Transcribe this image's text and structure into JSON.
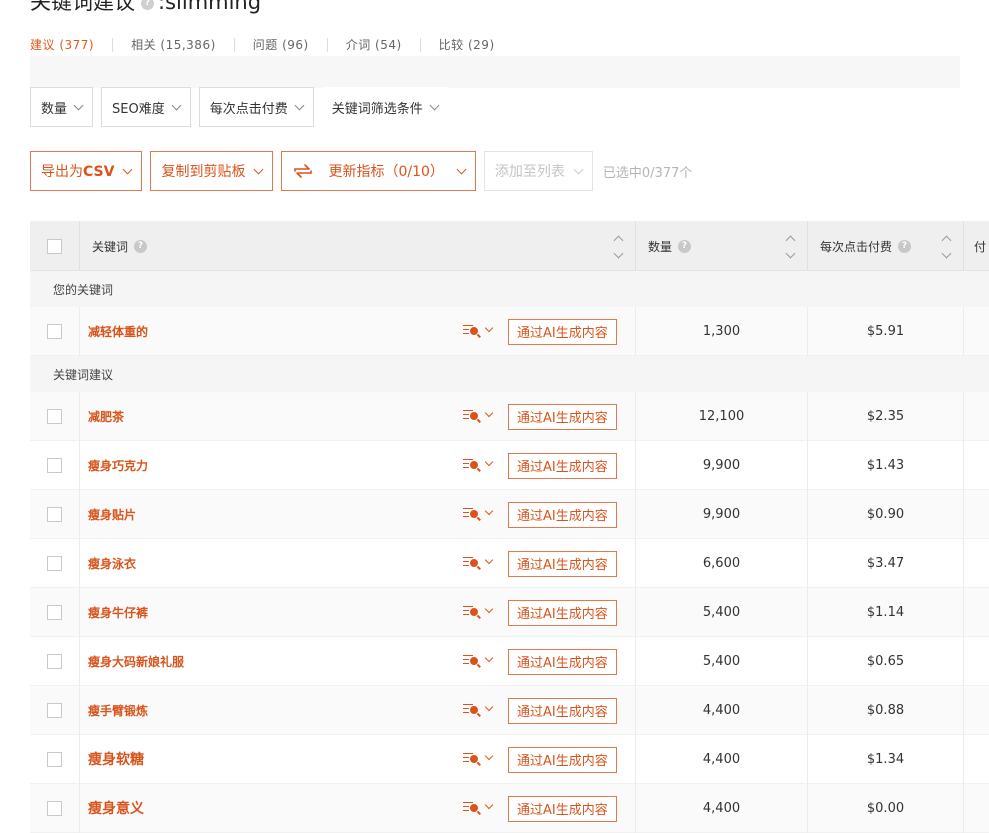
{
  "header": {
    "title": "关键词建议",
    "title_sep": ":",
    "query": "slimming",
    "help_glyph": "?"
  },
  "tabs": [
    {
      "label": "建议 (377)",
      "active": true
    },
    {
      "label": "相关 (15,386)",
      "active": false
    },
    {
      "label": "问题 (96)",
      "active": false
    },
    {
      "label": "介词 (54)",
      "active": false
    },
    {
      "label": "比较 (29)",
      "active": false
    }
  ],
  "filters": [
    {
      "label": "数量"
    },
    {
      "label": "SEO难度"
    },
    {
      "label": "每次点击付费"
    },
    {
      "label": "关键词筛选条件"
    }
  ],
  "actions": {
    "export_prefix": "导出为",
    "export_bold": "CSV",
    "copy": "复制到剪贴板",
    "update_metrics": "更新指标（0/10）",
    "add_to_list": "添加至列表",
    "selected": "已选中0/377个"
  },
  "table": {
    "columns": {
      "keyword": "关键词",
      "volume": "数量",
      "cpc": "每次点击付费",
      "more": "付"
    },
    "groups": {
      "yours": "您的关键词",
      "suggestions": "关键词建议"
    },
    "ai_button": "通过AI生成内容",
    "your_rows": [
      {
        "keyword": "减轻体重的",
        "volume": "1,300",
        "cpc": "$5.91"
      }
    ],
    "rows": [
      {
        "keyword": "减肥茶",
        "volume": "12,100",
        "cpc": "$2.35"
      },
      {
        "keyword": "瘦身巧克力",
        "volume": "9,900",
        "cpc": "$1.43"
      },
      {
        "keyword": "瘦身贴片",
        "volume": "9,900",
        "cpc": "$0.90"
      },
      {
        "keyword": "瘦身泳衣",
        "volume": "6,600",
        "cpc": "$3.47"
      },
      {
        "keyword": "瘦身牛仔裤",
        "volume": "5,400",
        "cpc": "$1.14"
      },
      {
        "keyword": "瘦身大码新娘礼服",
        "volume": "5,400",
        "cpc": "$0.65"
      },
      {
        "keyword": "瘦手臂锻炼",
        "volume": "4,400",
        "cpc": "$0.88"
      },
      {
        "keyword": "瘦身软糖",
        "volume": "4,400",
        "cpc": "$1.34"
      },
      {
        "keyword": "瘦身意义",
        "volume": "4,400",
        "cpc": "$0.00"
      }
    ]
  },
  "colors": {
    "accent": "#d9541c",
    "header_bg": "#efefef",
    "group_bg": "#f5f5f5"
  }
}
